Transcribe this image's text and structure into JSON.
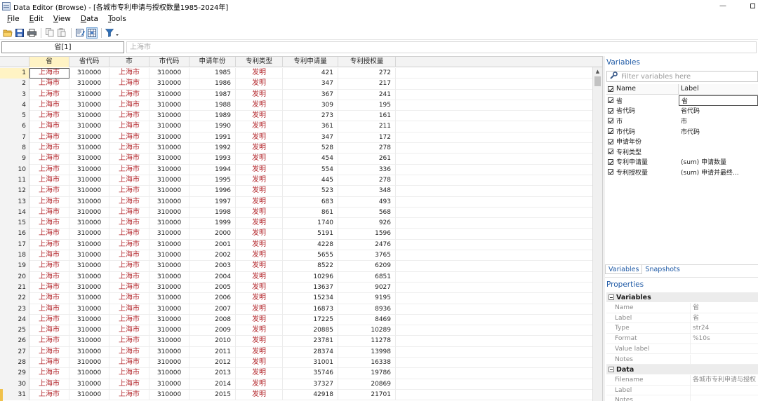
{
  "window": {
    "title": "Data Editor (Browse) - [各城市专利申请与授权数量1985-2024年]",
    "minimize_glyph": "—"
  },
  "menu": [
    {
      "name": "file",
      "hot": "F",
      "rest": "ile"
    },
    {
      "name": "edit",
      "hot": "E",
      "rest": "dit"
    },
    {
      "name": "view",
      "hot": "V",
      "rest": "iew"
    },
    {
      "name": "data",
      "hot": "D",
      "rest": "ata"
    },
    {
      "name": "tools",
      "hot": "T",
      "rest": "ools"
    }
  ],
  "toolbar": {
    "icons": [
      "open-icon",
      "save-icon",
      "print-icon",
      "copy-icon",
      "paste-icon",
      "edit-mode-icon",
      "browse-mode-icon",
      "filter-icon"
    ]
  },
  "entry": {
    "varname": "省[1]",
    "value": "上海市"
  },
  "grid": {
    "columns": [
      "省",
      "省代码",
      "市",
      "市代码",
      "申请年份",
      "专利类型",
      "专利申请量",
      "专利授权量"
    ],
    "rows": [
      [
        "1",
        "上海市",
        "310000",
        "上海市",
        "310000",
        "1985",
        "发明",
        "421",
        "272"
      ],
      [
        "2",
        "上海市",
        "310000",
        "上海市",
        "310000",
        "1986",
        "发明",
        "347",
        "217"
      ],
      [
        "3",
        "上海市",
        "310000",
        "上海市",
        "310000",
        "1987",
        "发明",
        "367",
        "241"
      ],
      [
        "4",
        "上海市",
        "310000",
        "上海市",
        "310000",
        "1988",
        "发明",
        "309",
        "195"
      ],
      [
        "5",
        "上海市",
        "310000",
        "上海市",
        "310000",
        "1989",
        "发明",
        "273",
        "161"
      ],
      [
        "6",
        "上海市",
        "310000",
        "上海市",
        "310000",
        "1990",
        "发明",
        "361",
        "211"
      ],
      [
        "7",
        "上海市",
        "310000",
        "上海市",
        "310000",
        "1991",
        "发明",
        "347",
        "172"
      ],
      [
        "8",
        "上海市",
        "310000",
        "上海市",
        "310000",
        "1992",
        "发明",
        "528",
        "278"
      ],
      [
        "9",
        "上海市",
        "310000",
        "上海市",
        "310000",
        "1993",
        "发明",
        "454",
        "261"
      ],
      [
        "10",
        "上海市",
        "310000",
        "上海市",
        "310000",
        "1994",
        "发明",
        "554",
        "336"
      ],
      [
        "11",
        "上海市",
        "310000",
        "上海市",
        "310000",
        "1995",
        "发明",
        "445",
        "278"
      ],
      [
        "12",
        "上海市",
        "310000",
        "上海市",
        "310000",
        "1996",
        "发明",
        "523",
        "348"
      ],
      [
        "13",
        "上海市",
        "310000",
        "上海市",
        "310000",
        "1997",
        "发明",
        "683",
        "493"
      ],
      [
        "14",
        "上海市",
        "310000",
        "上海市",
        "310000",
        "1998",
        "发明",
        "861",
        "568"
      ],
      [
        "15",
        "上海市",
        "310000",
        "上海市",
        "310000",
        "1999",
        "发明",
        "1740",
        "926"
      ],
      [
        "16",
        "上海市",
        "310000",
        "上海市",
        "310000",
        "2000",
        "发明",
        "5191",
        "1596"
      ],
      [
        "17",
        "上海市",
        "310000",
        "上海市",
        "310000",
        "2001",
        "发明",
        "4228",
        "2476"
      ],
      [
        "18",
        "上海市",
        "310000",
        "上海市",
        "310000",
        "2002",
        "发明",
        "5655",
        "3765"
      ],
      [
        "19",
        "上海市",
        "310000",
        "上海市",
        "310000",
        "2003",
        "发明",
        "8522",
        "6209"
      ],
      [
        "20",
        "上海市",
        "310000",
        "上海市",
        "310000",
        "2004",
        "发明",
        "10296",
        "6851"
      ],
      [
        "21",
        "上海市",
        "310000",
        "上海市",
        "310000",
        "2005",
        "发明",
        "13637",
        "9027"
      ],
      [
        "22",
        "上海市",
        "310000",
        "上海市",
        "310000",
        "2006",
        "发明",
        "15234",
        "9195"
      ],
      [
        "23",
        "上海市",
        "310000",
        "上海市",
        "310000",
        "2007",
        "发明",
        "16873",
        "8936"
      ],
      [
        "24",
        "上海市",
        "310000",
        "上海市",
        "310000",
        "2008",
        "发明",
        "17225",
        "8469"
      ],
      [
        "25",
        "上海市",
        "310000",
        "上海市",
        "310000",
        "2009",
        "发明",
        "20885",
        "10289"
      ],
      [
        "26",
        "上海市",
        "310000",
        "上海市",
        "310000",
        "2010",
        "发明",
        "23781",
        "11278"
      ],
      [
        "27",
        "上海市",
        "310000",
        "上海市",
        "310000",
        "2011",
        "发明",
        "28374",
        "13998"
      ],
      [
        "28",
        "上海市",
        "310000",
        "上海市",
        "310000",
        "2012",
        "发明",
        "31001",
        "16338"
      ],
      [
        "29",
        "上海市",
        "310000",
        "上海市",
        "310000",
        "2013",
        "发明",
        "35746",
        "19786"
      ],
      [
        "30",
        "上海市",
        "310000",
        "上海市",
        "310000",
        "2014",
        "发明",
        "37327",
        "20869"
      ],
      [
        "31",
        "上海市",
        "310000",
        "上海市",
        "310000",
        "2015",
        "发明",
        "42918",
        "21701"
      ]
    ]
  },
  "variables_panel": {
    "title": "Variables",
    "filter_placeholder": "Filter variables here",
    "col_name": "Name",
    "col_label": "Label",
    "items": [
      {
        "name": "省",
        "label": "省"
      },
      {
        "name": "省代码",
        "label": "省代码"
      },
      {
        "name": "市",
        "label": "市"
      },
      {
        "name": "市代码",
        "label": "市代码"
      },
      {
        "name": "申请年份",
        "label": ""
      },
      {
        "name": "专利类型",
        "label": ""
      },
      {
        "name": "专利申请量",
        "label": "(sum) 申请数量"
      },
      {
        "name": "专利授权量",
        "label": "(sum) 申请并最终..."
      }
    ]
  },
  "tabs": {
    "variables": "Variables",
    "snapshots": "Snapshots"
  },
  "properties": {
    "title": "Properties",
    "section_variables": "Variables",
    "variables_rows": [
      {
        "name": "Name",
        "value": "省"
      },
      {
        "name": "Label",
        "value": "省"
      },
      {
        "name": "Type",
        "value": "str24"
      },
      {
        "name": "Format",
        "value": "%10s"
      },
      {
        "name": "Value label",
        "value": ""
      },
      {
        "name": "Notes",
        "value": ""
      }
    ],
    "section_data": "Data",
    "data_rows": [
      {
        "name": "Filename",
        "value": "各城市专利申请与授权"
      },
      {
        "name": "Label",
        "value": ""
      },
      {
        "name": "Notes",
        "value": ""
      }
    ]
  }
}
